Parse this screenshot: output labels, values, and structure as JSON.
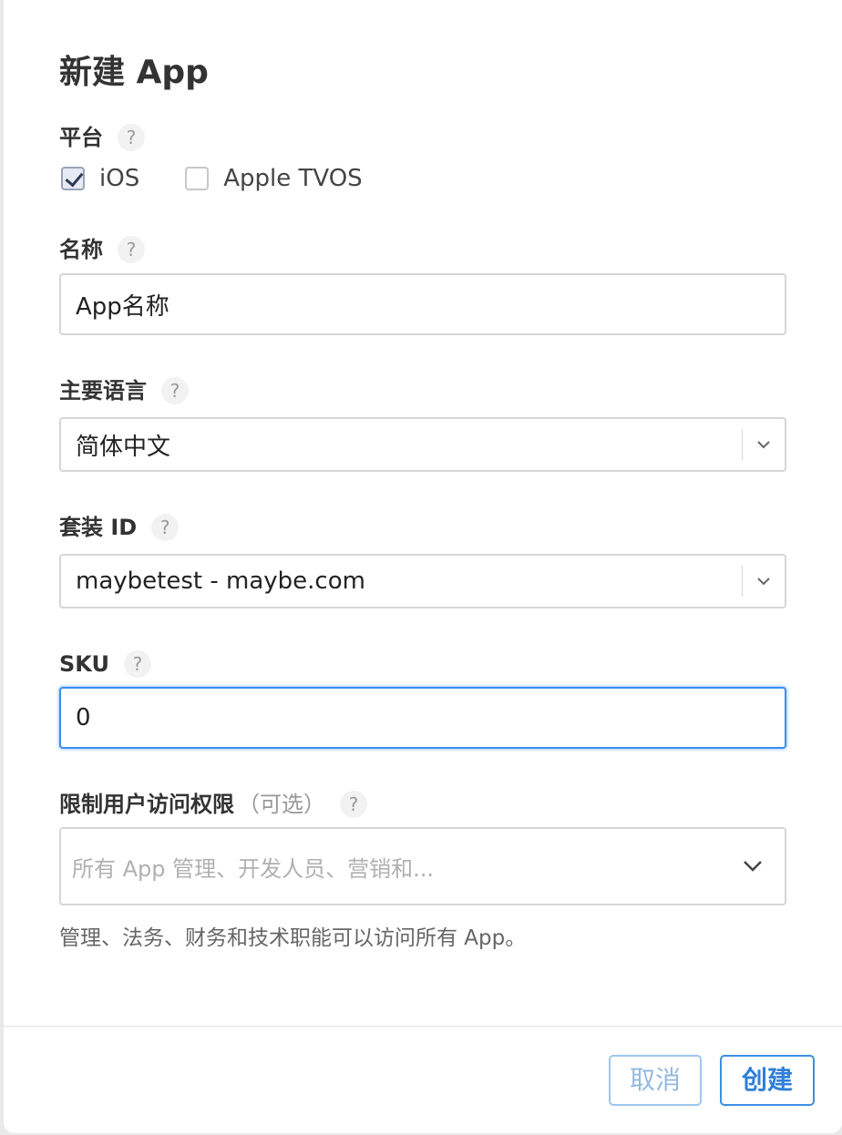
{
  "dialog": {
    "title": "新建 App",
    "help_glyph": "?"
  },
  "platform": {
    "label": "平台",
    "options": [
      {
        "label": "iOS",
        "checked": true
      },
      {
        "label": "Apple TVOS",
        "checked": false
      }
    ]
  },
  "name": {
    "label": "名称",
    "value": "App名称"
  },
  "primary_language": {
    "label": "主要语言",
    "selected": "简体中文"
  },
  "bundle_id": {
    "label": "套装 ID",
    "selected": "maybetest - maybe.com"
  },
  "sku": {
    "label": "SKU",
    "value": "0"
  },
  "user_access": {
    "label": "限制用户访问权限",
    "optional_label": "（可选）",
    "placeholder": "所有 App 管理、开发人员、营销和...",
    "note": "管理、法务、财务和技术职能可以访问所有 App。"
  },
  "footer": {
    "cancel_label": "取消",
    "create_label": "创建"
  },
  "icons": {
    "check": "checkmark-icon",
    "dropdown": "chevron-down-icon",
    "help": "help-icon"
  },
  "colors": {
    "accent": "#3b8ee6",
    "focus_border": "#3a8ff0"
  }
}
